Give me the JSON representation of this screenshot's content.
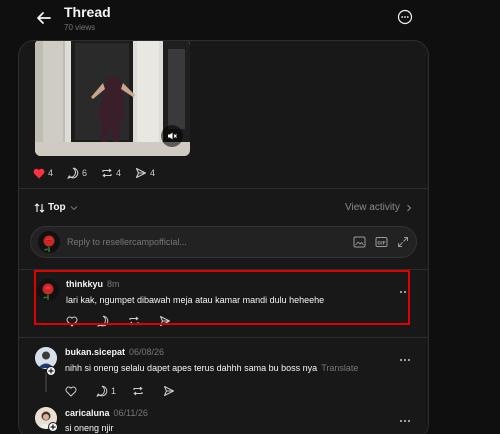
{
  "header": {
    "title": "Thread",
    "views": "70 views",
    "back_icon": "arrow-left-icon",
    "more_icon": "more-circle-icon"
  },
  "post": {
    "media_icon": "video-thumbnail",
    "mute_icon": "speaker-muted-icon",
    "likes": "4",
    "comments": "6",
    "reposts": "4",
    "shares": "4",
    "like_color": "#ff3040"
  },
  "sort": {
    "label": "Top",
    "view_activity": "View activity"
  },
  "reply": {
    "placeholder": "Reply to resellercampofficial..."
  },
  "comments": [
    {
      "username": "thinkkyu",
      "time": "8m",
      "text": "lari kak, ngumpet dibawah meja atau kamar mandi dulu heheehe",
      "likes": "",
      "replies": ""
    },
    {
      "username": "bukan.sicepat",
      "time": "06/08/26",
      "text": "nihh si oneng selalu dapet apes terus dahhh sama bu boss nya",
      "translate": "Translate",
      "likes": "",
      "replies": "1"
    },
    {
      "username": "caricaluna",
      "time": "06/11/26",
      "text": "si oneng njir"
    }
  ],
  "colors": {
    "highlight": "#e00000",
    "background": "#0f0f0f",
    "panel": "#181818"
  }
}
